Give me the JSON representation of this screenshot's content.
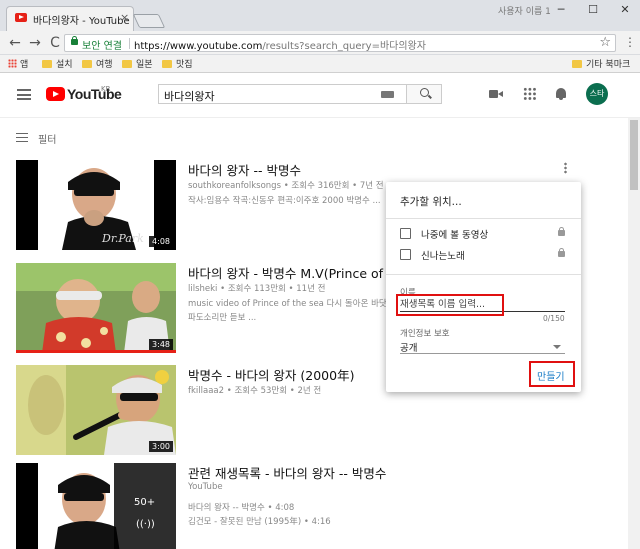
{
  "browser": {
    "tab_title": "바다의왕자 - YouTube",
    "tab_close": "×",
    "window_user": "사용자 이름 1",
    "window_min": "─",
    "window_max": "☐",
    "window_close": "✕",
    "nav_back": "←",
    "nav_forward": "→",
    "nav_reload": "C",
    "secure_label": "보안 연결",
    "url_domain": "https://www.youtube.com",
    "url_path": "/results?search_query=바다의왕자",
    "star": "☆",
    "menu": "⋮",
    "bookmarks": [
      {
        "label": "앱",
        "icon": "apps-icon"
      },
      {
        "label": "설치",
        "icon": "folder-icon"
      },
      {
        "label": "여행",
        "icon": "folder-icon"
      },
      {
        "label": "일본",
        "icon": "folder-icon"
      },
      {
        "label": "맛집",
        "icon": "folder-icon"
      }
    ],
    "other_bookmarks": "기타 북마크"
  },
  "header": {
    "logo_text": "YouTube",
    "region": "KR",
    "search_query": "바다의왕자",
    "avatar_text": "스타"
  },
  "filter_label": "필터",
  "results": [
    {
      "title": "바다의 왕자 -- 박명수",
      "meta": "southkoreanfolksongs • 조회수 316만회 • 7년 전",
      "desc": [
        "작사:임용수 작곡:신동우 편곡:이주호 2000 박명수 ..."
      ],
      "duration": "4:08",
      "watched": false
    },
    {
      "title": "바다의 왕자 - 박명수 M.V(Prince of the",
      "meta": "lilsheki • 조회수 113만회 • 11년 전",
      "desc": [
        "music video of Prince of the sea 다시 돌아온 바닷가",
        "파도소리만 듣보 ..."
      ],
      "duration": "3:48",
      "watched": true
    },
    {
      "title": "박명수 - 바다의 왕자 (2000年)",
      "meta": "fkillaaa2 • 조회수 53만회 • 2년 전",
      "desc": [],
      "duration": "3:00",
      "watched": false
    },
    {
      "title": "관련 재생목록 - 바다의 왕자 -- 박명수",
      "meta": "YouTube",
      "desc": [
        "바다의 왕자 -- 박명수 • 4:08",
        "김건모 - 잘못된 만남 (1995年) • 4:16"
      ],
      "duration": "",
      "playlist_count": "50+",
      "watched": false
    }
  ],
  "dialog": {
    "title": "추가할 위치...",
    "playlists": [
      {
        "label": "나중에 볼 동영상",
        "checked": false
      },
      {
        "label": "신나는노래",
        "checked": false
      }
    ],
    "name_label": "이름",
    "name_placeholder": "재생목록 이름 입력...",
    "char_count": "0/150",
    "privacy_label": "개인정보 보호",
    "privacy_value": "공개",
    "create_label": "만들기"
  },
  "thumbnail_text": {
    "signature": "Dr.Park"
  },
  "colors": {
    "youtube_red": "#ff0000",
    "link_blue": "#167ac6",
    "highlight_red": "#e01010",
    "avatar_green": "#0b6e4f"
  }
}
